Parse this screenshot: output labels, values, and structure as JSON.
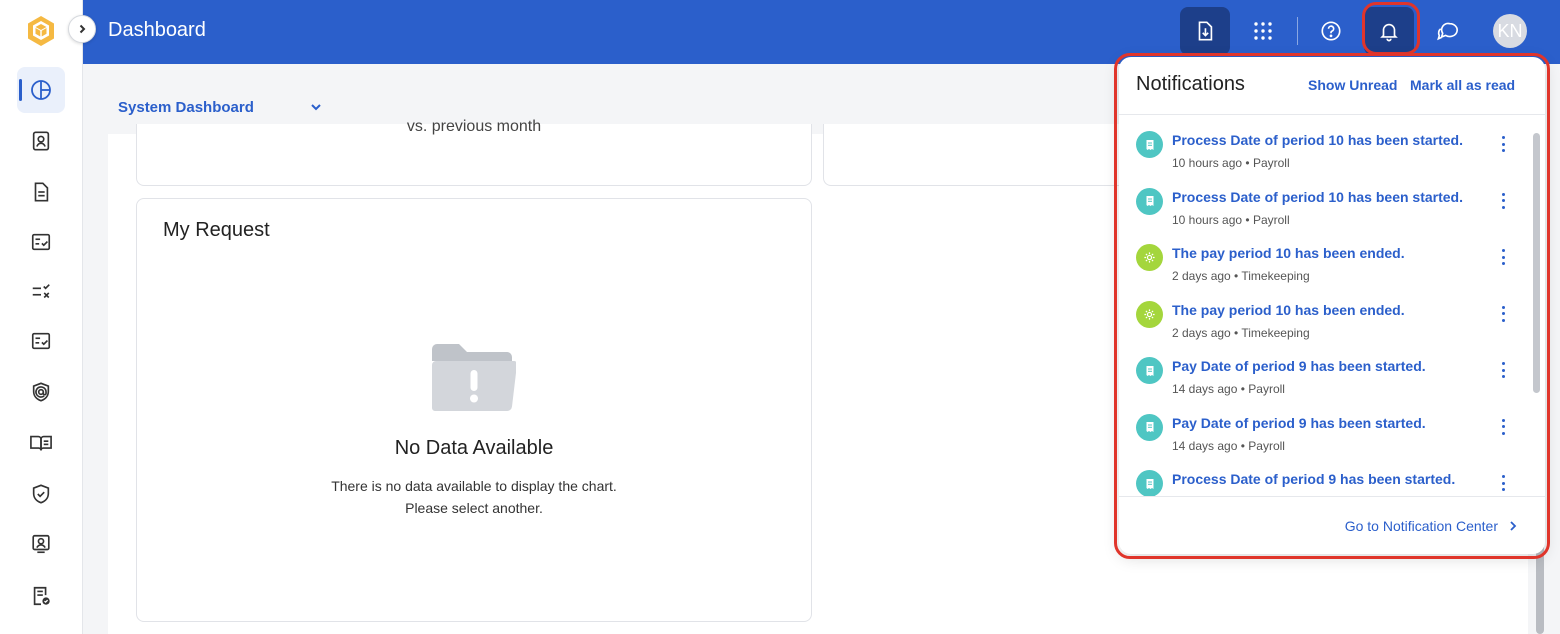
{
  "topbar": {
    "title": "Dashboard",
    "avatar_initials": "KN",
    "accent_color": "#2b5fcb"
  },
  "subheader": {
    "dashboard_select": "System Dashboard"
  },
  "content": {
    "comparison_text": "vs. previous month",
    "my_request": {
      "title": "My Request",
      "empty_title": "No Data Available",
      "empty_line1": "There is no data available to display the chart.",
      "empty_line2": "Please select another."
    }
  },
  "sidebar": {
    "items": [
      {
        "icon": "dashboard-pie-icon",
        "active": true
      },
      {
        "icon": "employee-badge-icon"
      },
      {
        "icon": "document-icon"
      },
      {
        "icon": "checklist-icon"
      },
      {
        "icon": "task-list-icon"
      },
      {
        "icon": "approval-checklist-icon"
      },
      {
        "icon": "at-shield-icon"
      },
      {
        "icon": "book-icon"
      },
      {
        "icon": "shield-check-icon"
      },
      {
        "icon": "profile-card-icon"
      },
      {
        "icon": "report-check-icon"
      }
    ]
  },
  "notifications": {
    "title": "Notifications",
    "show_unread": "Show Unread",
    "mark_all_read": "Mark all as read",
    "footer_link": "Go to Notification Center",
    "items": [
      {
        "message": "Process Date of period 10 has been started.",
        "time": "10 hours ago",
        "category": "Payroll",
        "type": "payroll"
      },
      {
        "message": "Process Date of period 10 has been started.",
        "time": "10 hours ago",
        "category": "Payroll",
        "type": "payroll"
      },
      {
        "message": "The pay period 10 has been ended.",
        "time": "2 days ago",
        "category": "Timekeeping",
        "type": "timekeeping"
      },
      {
        "message": "The pay period 10 has been ended.",
        "time": "2 days ago",
        "category": "Timekeeping",
        "type": "timekeeping"
      },
      {
        "message": "Pay Date of period 9 has been started.",
        "time": "14 days ago",
        "category": "Payroll",
        "type": "payroll"
      },
      {
        "message": "Pay Date of period 9 has been started.",
        "time": "14 days ago",
        "category": "Payroll",
        "type": "payroll"
      },
      {
        "message": "Process Date of period 9 has been started.",
        "time": "",
        "category": "",
        "type": "payroll"
      }
    ]
  }
}
